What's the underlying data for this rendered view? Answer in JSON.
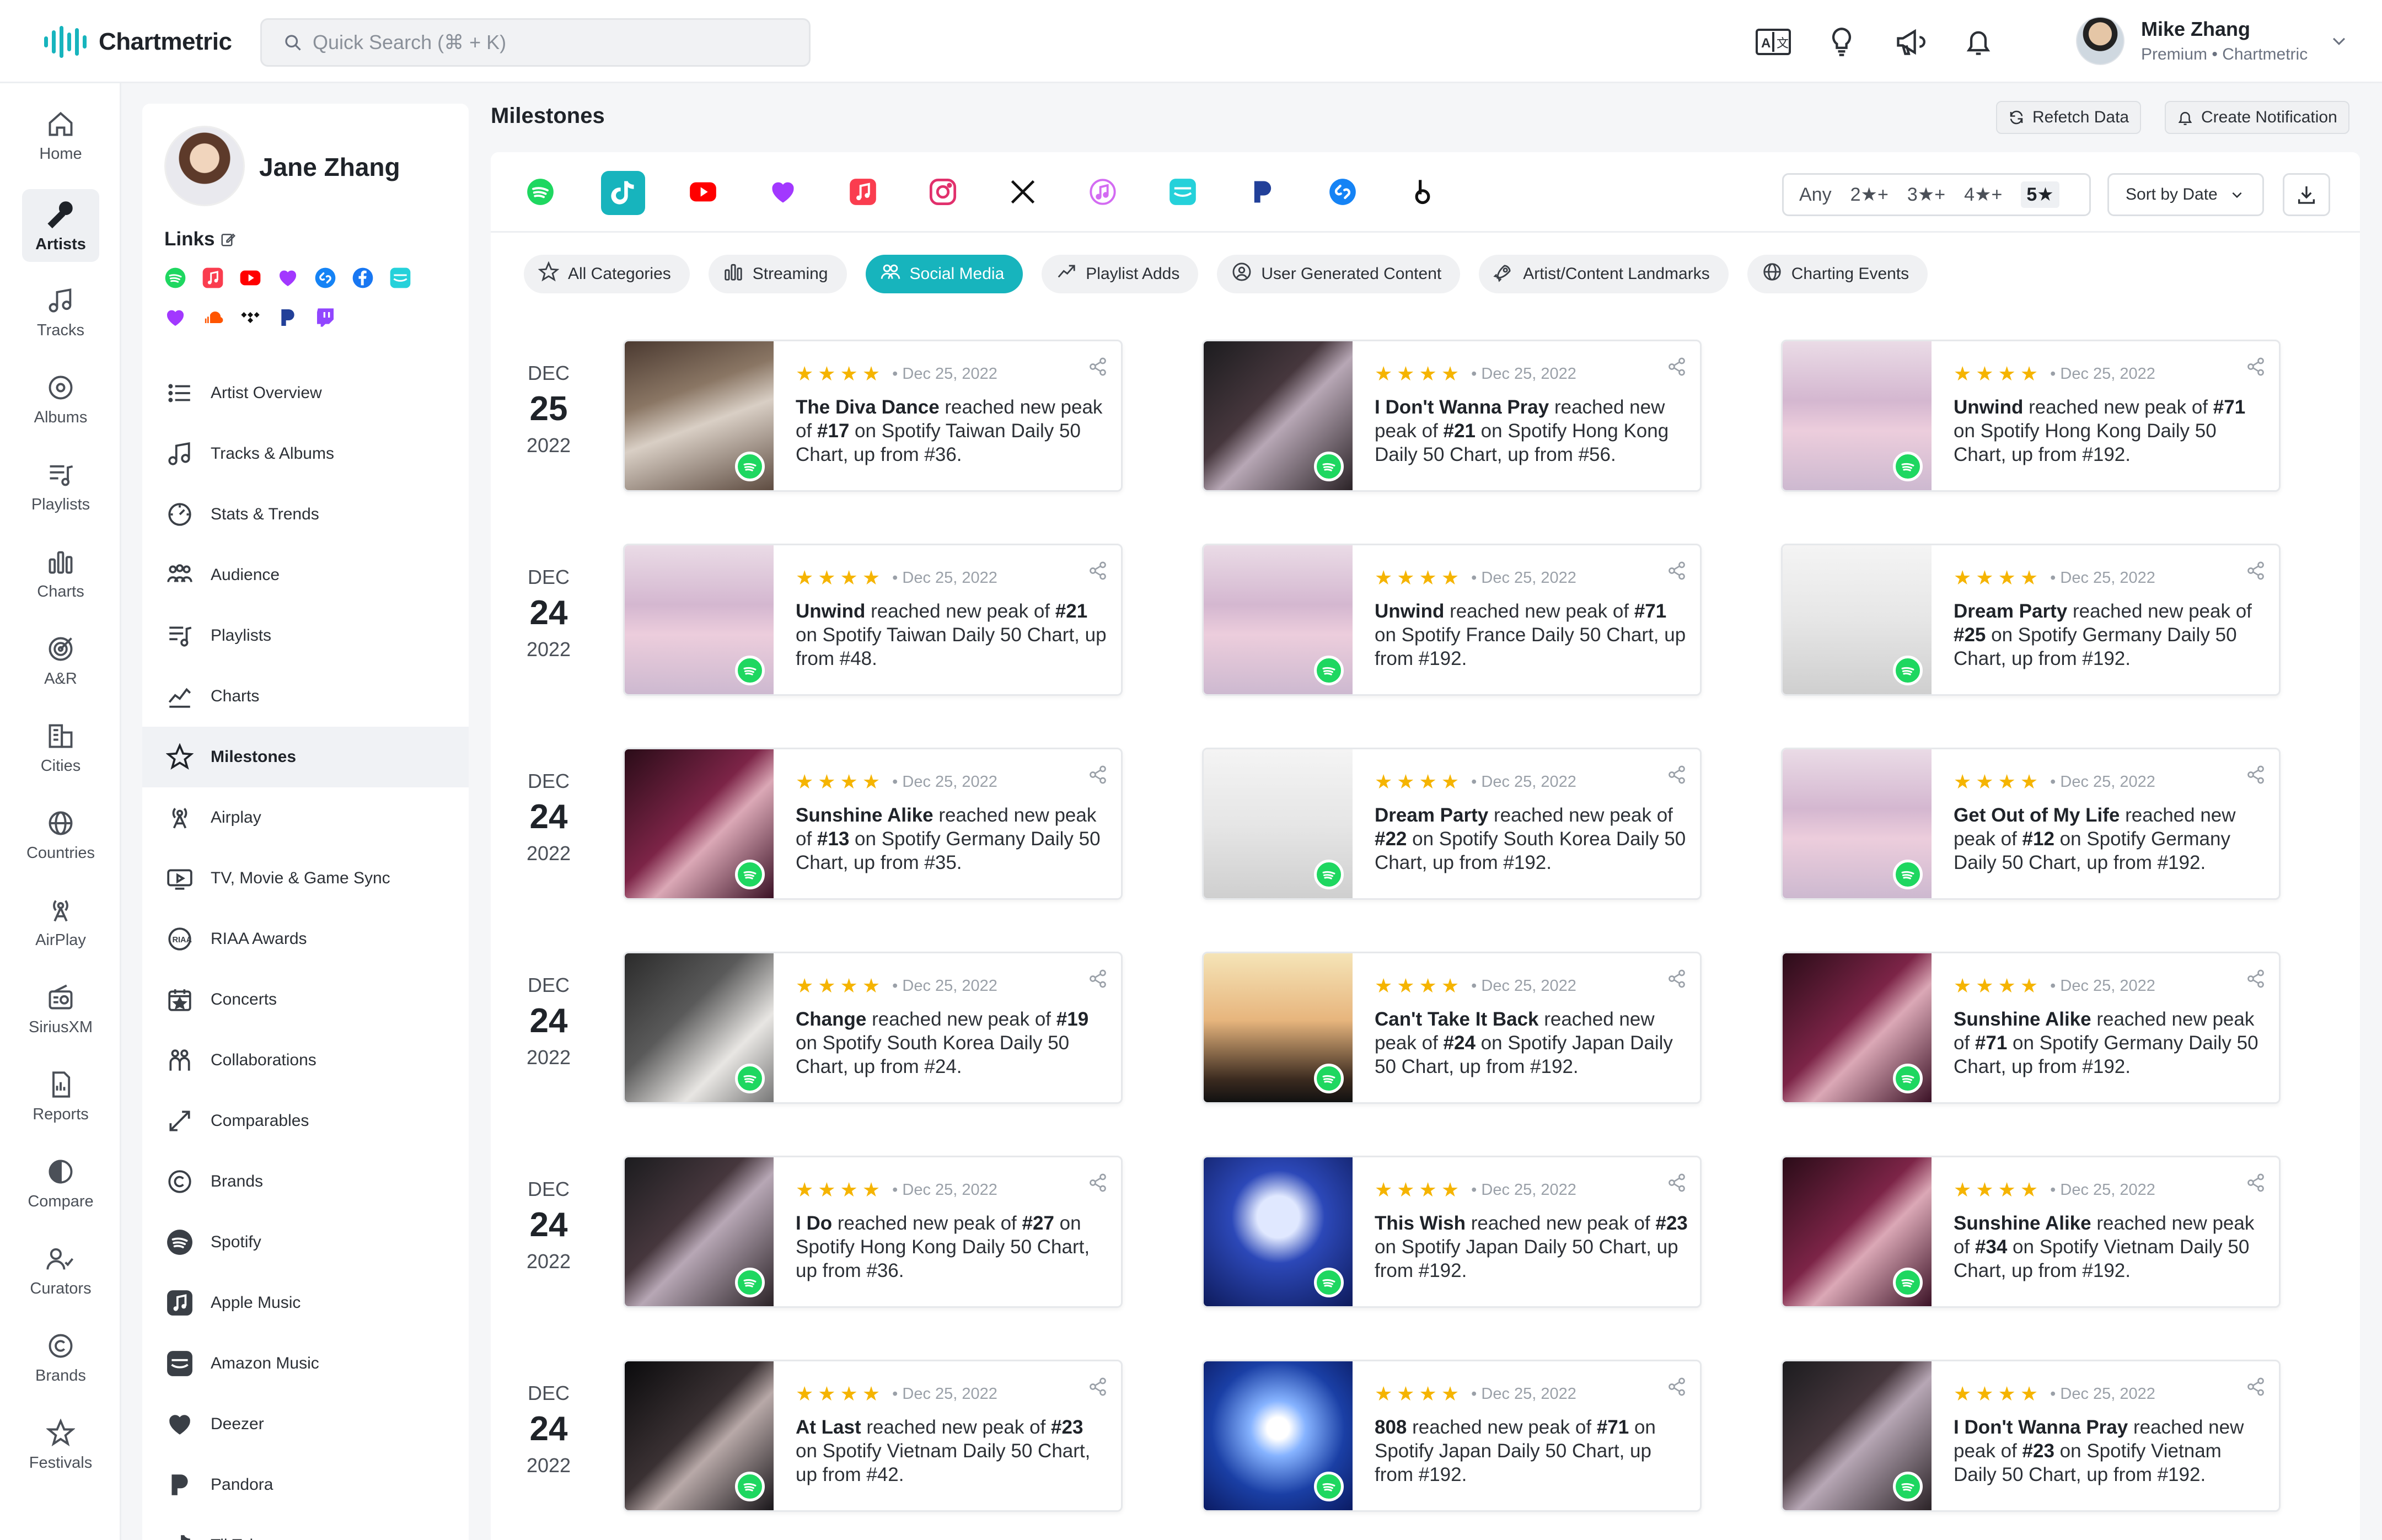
{
  "app": {
    "name": "Chartmetric"
  },
  "search": {
    "placeholder": "Quick Search (⌘ + K)"
  },
  "top_icons": [
    "translate-icon",
    "lightbulb-icon",
    "megaphone-icon",
    "bell-icon"
  ],
  "user": {
    "name": "Mike Zhang",
    "subtitle": "Premium • Chartmetric"
  },
  "left_nav": [
    {
      "label": "Home",
      "icon": "home-icon"
    },
    {
      "label": "Artists",
      "icon": "microphone-icon",
      "active": true
    },
    {
      "label": "Tracks",
      "icon": "music-note-icon"
    },
    {
      "label": "Albums",
      "icon": "disc-icon"
    },
    {
      "label": "Playlists",
      "icon": "playlist-icon"
    },
    {
      "label": "Charts",
      "icon": "bar-chart-icon"
    },
    {
      "label": "A&R",
      "icon": "target-icon"
    },
    {
      "label": "Cities",
      "icon": "buildings-icon"
    },
    {
      "label": "Countries",
      "icon": "globe-icon"
    },
    {
      "label": "AirPlay",
      "icon": "broadcast-icon"
    },
    {
      "label": "SiriusXM",
      "icon": "radio-icon"
    },
    {
      "label": "Reports",
      "icon": "report-icon"
    },
    {
      "label": "Compare",
      "icon": "half-circle-icon"
    },
    {
      "label": "Curators",
      "icon": "users-icon"
    },
    {
      "label": "Brands",
      "icon": "copyright-icon"
    },
    {
      "label": "Festivals",
      "icon": "festival-icon"
    }
  ],
  "artist": {
    "name": "Jane Zhang",
    "links_title": "Links",
    "links": [
      {
        "name": "spotify",
        "color": "#1ed760"
      },
      {
        "name": "apple-music",
        "color": "#fa3d4f"
      },
      {
        "name": "youtube",
        "color": "#ff0000"
      },
      {
        "name": "deezer",
        "color": "#a238ff"
      },
      {
        "name": "shazam",
        "color": "#1583f5"
      },
      {
        "name": "facebook",
        "color": "#1877f2"
      },
      {
        "name": "amazon-music",
        "color": "#25d1da"
      },
      {
        "name": "deezer-heart",
        "color": "#a238ff"
      },
      {
        "name": "soundcloud",
        "color": "#ff5500"
      },
      {
        "name": "tidal",
        "color": "#111111"
      },
      {
        "name": "pandora",
        "color": "#224099"
      },
      {
        "name": "twitch",
        "color": "#9146ff"
      }
    ],
    "menu": [
      {
        "label": "Artist Overview",
        "icon": "list-icon"
      },
      {
        "label": "Tracks & Albums",
        "icon": "music-note-icon"
      },
      {
        "label": "Stats & Trends",
        "icon": "gauge-icon"
      },
      {
        "label": "Audience",
        "icon": "audience-icon"
      },
      {
        "label": "Playlists",
        "icon": "playlist-icon"
      },
      {
        "label": "Charts",
        "icon": "chart-icon"
      },
      {
        "label": "Milestones",
        "icon": "star-icon",
        "active": true
      },
      {
        "label": "Airplay",
        "icon": "broadcast-icon"
      },
      {
        "label": "TV, Movie & Game Sync",
        "icon": "tv-icon"
      },
      {
        "label": "RIAA Awards",
        "icon": "riaa-icon"
      },
      {
        "label": "Concerts",
        "icon": "calendar-star-icon"
      },
      {
        "label": "Collaborations",
        "icon": "collab-icon"
      },
      {
        "label": "Comparables",
        "icon": "compare-arrows-icon"
      },
      {
        "label": "Brands",
        "icon": "copyright-icon"
      },
      {
        "label": "Spotify",
        "icon": "spotify-icon"
      },
      {
        "label": "Apple Music",
        "icon": "apple-music-icon"
      },
      {
        "label": "Amazon Music",
        "icon": "amazon-music-icon"
      },
      {
        "label": "Deezer",
        "icon": "deezer-icon"
      },
      {
        "label": "Pandora",
        "icon": "pandora-icon"
      },
      {
        "label": "TikTok",
        "icon": "tiktok-icon"
      }
    ]
  },
  "page": {
    "title": "Milestones",
    "refetch_label": "Refetch Data",
    "notify_label": "Create Notification"
  },
  "platforms": [
    {
      "name": "spotify",
      "color": "#1ed760"
    },
    {
      "name": "tiktok",
      "color": "#17b4bd",
      "active": true
    },
    {
      "name": "youtube",
      "color": "#ff0000"
    },
    {
      "name": "deezer",
      "color": "#a238ff"
    },
    {
      "name": "apple-music",
      "color": "#fa3d4f"
    },
    {
      "name": "instagram",
      "color": "#e1306c"
    },
    {
      "name": "x-twitter",
      "color": "#111111"
    },
    {
      "name": "itunes",
      "color": "#d36bf2"
    },
    {
      "name": "amazon-music",
      "color": "#25d1da"
    },
    {
      "name": "pandora",
      "color": "#224099"
    },
    {
      "name": "shazam",
      "color": "#1583f5"
    },
    {
      "name": "beatport",
      "color": "#111111"
    }
  ],
  "star_filter": {
    "options": [
      "Any",
      "2★+",
      "3★+",
      "4★+",
      "5★"
    ],
    "selected": "5★"
  },
  "sort": {
    "label": "Sort by Date"
  },
  "categories": [
    {
      "label": "All Categories",
      "icon": "star-outline-icon"
    },
    {
      "label": "Streaming",
      "icon": "bar-chart-icon"
    },
    {
      "label": "Social Media",
      "icon": "users-icon",
      "active": true
    },
    {
      "label": "Playlist Adds",
      "icon": "trend-icon"
    },
    {
      "label": "User Generated Content",
      "icon": "user-circle-icon"
    },
    {
      "label": "Artist/Content Landmarks",
      "icon": "rocket-icon"
    },
    {
      "label": "Charting Events",
      "icon": "globe-icon"
    }
  ],
  "milestone_rows": [
    {
      "month": "DEC",
      "day": "25",
      "year": "2022",
      "cards": [
        {
          "date": "Dec 25, 2022",
          "title": "The Diva Dance",
          "text": " reached new peak of #17 on Spotify Taiwan Daily 50 Chart, up from #36.",
          "art": "art-a"
        },
        {
          "date": "Dec 25, 2022",
          "title": "I Don't Wanna Pray",
          "text": " reached new peak of #21 on Spotify Hong Kong Daily 50 Chart, up from #56.",
          "art": "art-b"
        },
        {
          "date": "Dec 25, 2022",
          "title": "Unwind",
          "text": " reached new peak of #71 on Spotify Hong Kong Daily 50 Chart, up from #192.",
          "art": "art-c"
        }
      ]
    },
    {
      "month": "DEC",
      "day": "24",
      "year": "2022",
      "cards": [
        {
          "date": "Dec 25, 2022",
          "title": "Unwind",
          "text": " reached new peak of #21 on Spotify Taiwan Daily 50 Chart, up from #48.",
          "art": "art-c"
        },
        {
          "date": "Dec 25, 2022",
          "title": "Unwind",
          "text": " reached new peak of #71 on Spotify France Daily 50 Chart, up from #192.",
          "art": "art-c"
        },
        {
          "date": "Dec 25, 2022",
          "title": "Dream Party",
          "text": " reached new peak of #25 on Spotify Germany Daily 50 Chart, up from #192.",
          "art": "art-d"
        }
      ]
    },
    {
      "month": "DEC",
      "day": "24",
      "year": "2022",
      "cards": [
        {
          "date": "Dec 25, 2022",
          "title": "Sunshine Alike",
          "text": " reached new peak of #13 on Spotify Germany Daily 50 Chart, up from #35.",
          "art": "art-e"
        },
        {
          "date": "Dec 25, 2022",
          "title": "Dream Party",
          "text": " reached new peak of #22 on Spotify South Korea Daily 50 Chart, up from #192.",
          "art": "art-d"
        },
        {
          "date": "Dec 25, 2022",
          "title": "Get Out of My Life",
          "text": " reached new peak of #12 on Spotify Germany Daily 50 Chart, up from #192.",
          "art": "art-c"
        }
      ]
    },
    {
      "month": "DEC",
      "day": "24",
      "year": "2022",
      "cards": [
        {
          "date": "Dec 25, 2022",
          "title": "Change",
          "text": " reached new peak of #19 on Spotify South Korea Daily 50 Chart, up from #24.",
          "art": "art-f"
        },
        {
          "date": "Dec 25, 2022",
          "title": "Can't Take It Back",
          "text": " reached new peak of #24 on Spotify Japan Daily 50 Chart, up from #192.",
          "art": "art-g"
        },
        {
          "date": "Dec 25, 2022",
          "title": "Sunshine Alike",
          "text": " reached new peak of #71 on Spotify Germany Daily 50 Chart, up from #192.",
          "art": "art-e"
        }
      ]
    },
    {
      "month": "DEC",
      "day": "24",
      "year": "2022",
      "cards": [
        {
          "date": "Dec 25, 2022",
          "title": "I Do",
          "text": " reached new peak of #27 on Spotify Hong Kong Daily 50 Chart, up from #36.",
          "art": "art-b"
        },
        {
          "date": "Dec 25, 2022",
          "title": "This Wish",
          "text": " reached new peak of #23 on Spotify Japan Daily 50 Chart, up from #192.",
          "art": "art-i"
        },
        {
          "date": "Dec 25, 2022",
          "title": "Sunshine Alike",
          "text": " reached new peak of #34 on Spotify Vietnam Daily 50 Chart, up from #192.",
          "art": "art-e"
        }
      ]
    },
    {
      "month": "DEC",
      "day": "24",
      "year": "2022",
      "cards": [
        {
          "date": "Dec 25, 2022",
          "title": "At Last",
          "text": " reached new peak of #23 on Spotify Vietnam Daily 50 Chart, up from #42.",
          "art": "art-h"
        },
        {
          "date": "Dec 25, 2022",
          "title": "808",
          "text": " reached new peak of #71 on Spotify Japan Daily 50 Chart, up from #192.",
          "art": "art-j"
        },
        {
          "date": "Dec 25, 2022",
          "title": "I Don't Wanna Pray",
          "text": " reached new peak of #23 on Spotify Vietnam Daily 50 Chart, up from #192.",
          "art": "art-b"
        }
      ]
    }
  ]
}
